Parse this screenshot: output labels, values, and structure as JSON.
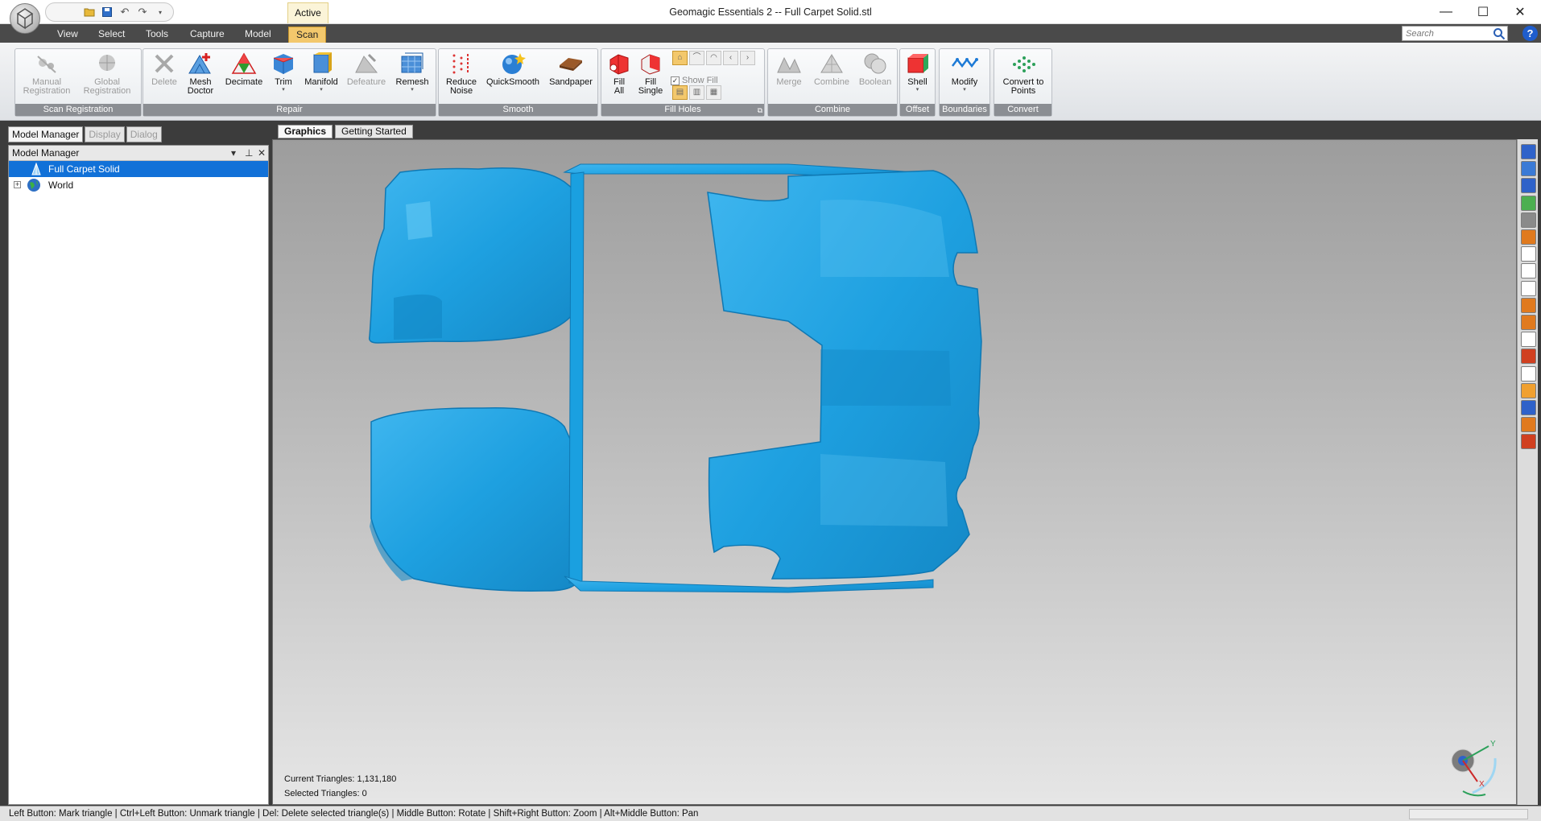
{
  "window": {
    "title": "Geomagic Essentials 2 -- Full Carpet Solid.stl",
    "context_tab": "Active",
    "minimize": "—",
    "maximize": "☐",
    "close": "✕"
  },
  "menu": {
    "tabs": [
      "View",
      "Select",
      "Tools",
      "Capture",
      "Model",
      "Scan"
    ],
    "active": "Scan"
  },
  "search": {
    "placeholder": "Search",
    "icon": "search-icon"
  },
  "help": "?",
  "ribbon": {
    "groups": [
      {
        "label": "Scan Registration",
        "buttons": [
          [
            "Manual",
            "Registration"
          ],
          [
            "Global",
            "Registration"
          ]
        ]
      },
      {
        "label": "Repair",
        "buttons": [
          [
            "Delete"
          ],
          [
            "Mesh",
            "Doctor"
          ],
          [
            "Decimate"
          ],
          [
            "Trim"
          ],
          [
            "Manifold"
          ],
          [
            "Defeature"
          ],
          [
            "Remesh"
          ]
        ]
      },
      {
        "label": "Smooth",
        "buttons": [
          [
            "Reduce",
            "Noise"
          ],
          [
            "QuickSmooth"
          ],
          [
            "Sandpaper"
          ]
        ]
      },
      {
        "label": "Fill Holes",
        "buttons": [
          [
            "Fill",
            "All"
          ],
          [
            "Fill",
            "Single"
          ]
        ],
        "show_fill": "Show Fill"
      },
      {
        "label": "Combine",
        "buttons": [
          [
            "Merge"
          ],
          [
            "Combine"
          ],
          [
            "Boolean"
          ]
        ]
      },
      {
        "label": "Offset",
        "buttons": [
          [
            "Shell"
          ]
        ]
      },
      {
        "label": "Boundaries",
        "buttons": [
          [
            "Modify"
          ]
        ]
      },
      {
        "label": "Convert",
        "buttons": [
          [
            "Convert to",
            "Points"
          ]
        ]
      }
    ]
  },
  "panel": {
    "tabs": [
      "Model Manager",
      "Display",
      "Dialog"
    ],
    "active": "Model Manager",
    "header": "Model Manager",
    "tree": [
      {
        "label": "Full Carpet Solid",
        "selected": true,
        "icon": "mesh-icon"
      },
      {
        "label": "World",
        "selected": false,
        "icon": "globe-icon",
        "expander": "+"
      }
    ]
  },
  "viewport": {
    "tabs": [
      "Graphics",
      "Getting Started"
    ],
    "active": "Graphics",
    "stats": {
      "current_triangles": "Current Triangles: 1,131,180",
      "selected_triangles": "Selected Triangles: 0"
    },
    "mesh_color": "#1ea0e0",
    "axis": {
      "y": "Y",
      "x": "X"
    }
  },
  "status": "Left Button: Mark triangle | Ctrl+Left Button: Unmark triangle | Del: Delete selected triangle(s) | Middle Button: Rotate | Shift+Right Button: Zoom | Alt+Middle Button: Pan"
}
